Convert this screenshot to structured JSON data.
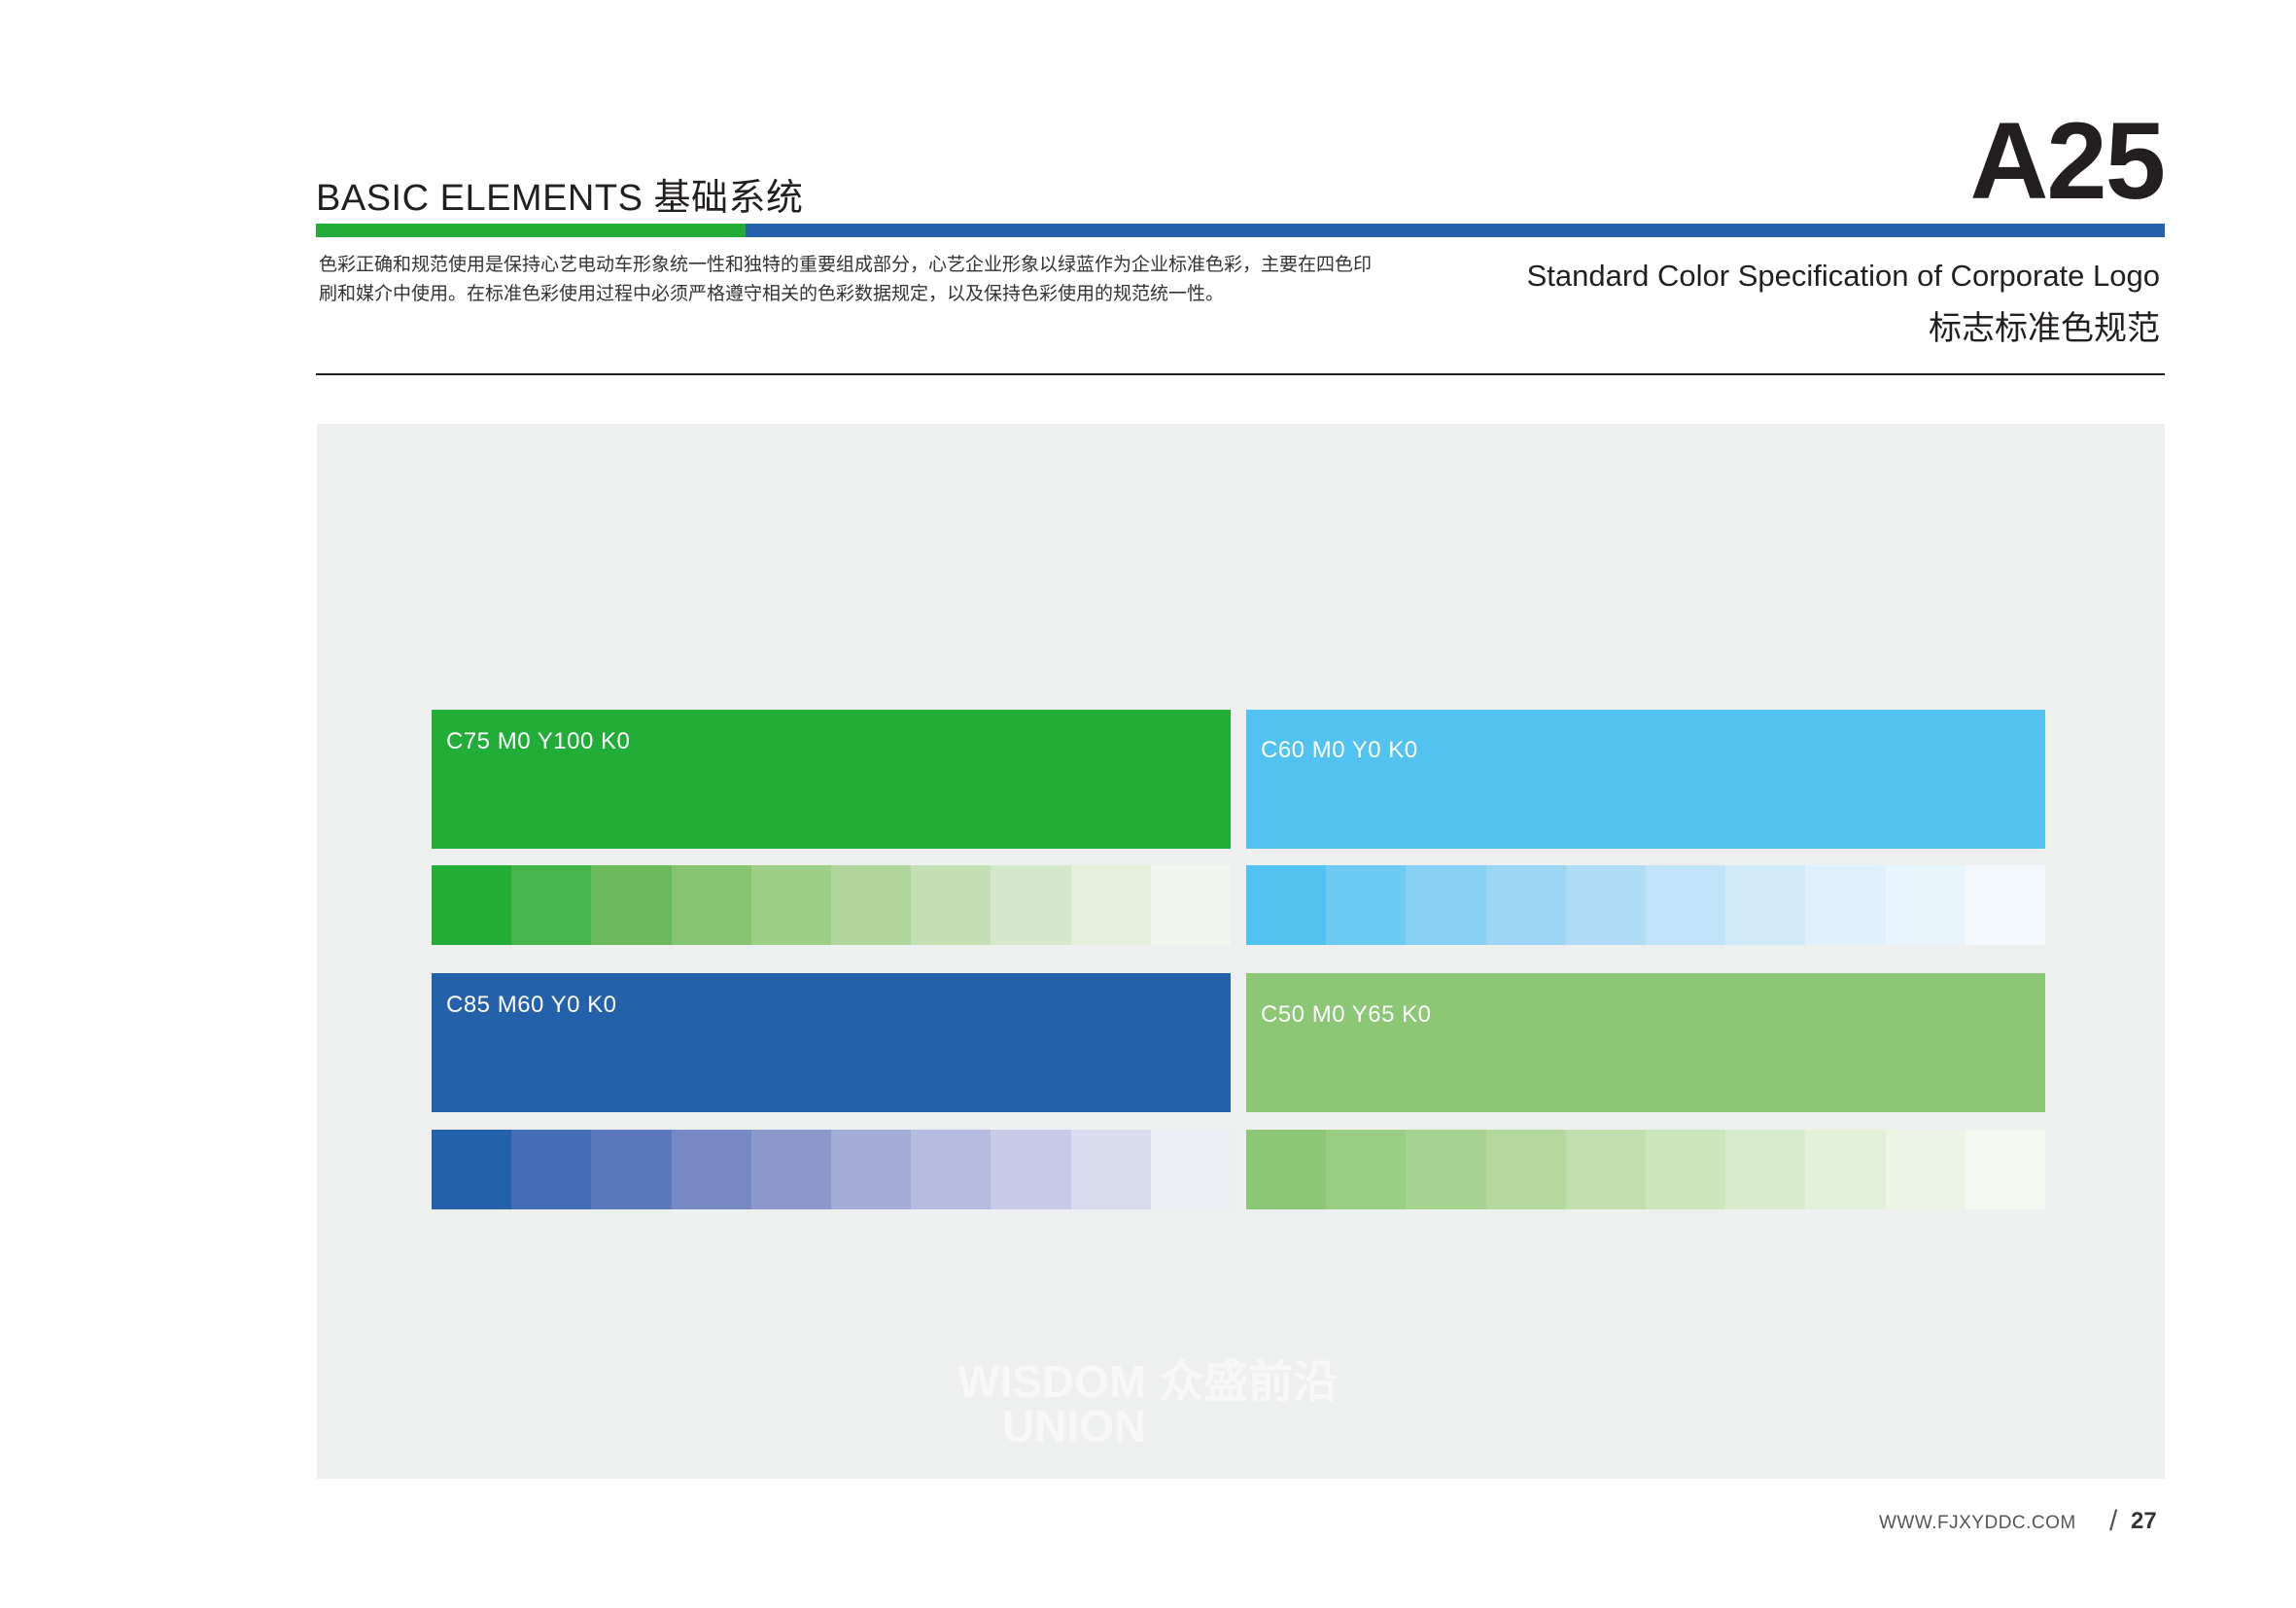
{
  "header": {
    "section_title": "BASIC ELEMENTS 基础系统",
    "page_code": "A25",
    "description_line1": "色彩正确和规范使用是保持心艺电动车形象统一性和独特的重要组成部分，心艺企业形象以绿蓝作为企业标准色彩，主要在四色印",
    "description_line2": "刷和媒介中使用。在标准色彩使用过程中必须严格遵守相关的色彩数据规定，以及保持色彩使用的规范统一性。",
    "title_en": "Standard Color Specification of Corporate Logo",
    "title_cn": "标志标准色规范"
  },
  "colors": {
    "accent_green": "#22ac38",
    "accent_blue": "#2560ab",
    "panel_bg": "#eef0ef"
  },
  "swatches": [
    {
      "label": "C75 M0 Y100 K0",
      "color": "#22ac38",
      "tints": [
        "#22ac38",
        "#46b54b",
        "#6bbb5c",
        "#86c46f",
        "#9dcf87",
        "#b1d79f",
        "#c4e0b4",
        "#d5e8c9",
        "#e4f0dc",
        "#f1f7ee"
      ]
    },
    {
      "label": "C60 M0 Y0 K0",
      "color": "#52c3f1",
      "tints": [
        "#52c3f1",
        "#6ccaf3",
        "#88d1f5",
        "#9bd6f4",
        "#b0ddf6",
        "#c2e4f8",
        "#d0eafa",
        "#def0fb",
        "#e9f5fc",
        "#f3f9fd"
      ]
    },
    {
      "label": "C85 M60 Y0 K0",
      "color": "#2560ab",
      "tints": [
        "#2560ab",
        "#456db6",
        "#5d79bd",
        "#7789c5",
        "#8d99cd",
        "#a2acd6",
        "#b5bce0",
        "#c7cbe7",
        "#d9dcef",
        "#eceef6"
      ]
    },
    {
      "label": "C50 M0 Y65 K0",
      "color": "#8bc774",
      "tints": [
        "#8bc774",
        "#98cd83",
        "#a7d392",
        "#b4d99f",
        "#c0dfae",
        "#cde5bd",
        "#d8ebcb",
        "#e3f0d9",
        "#ecf4e6",
        "#f4f8f1"
      ]
    }
  ],
  "watermark": {
    "line1": "WISDOM 众盛前沿",
    "line2": "UNION"
  },
  "footer": {
    "website": "WWW.FJXYDDC.COM",
    "separator": "/",
    "page_number": "27"
  }
}
